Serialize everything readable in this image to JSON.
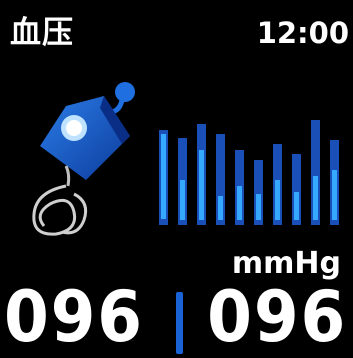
{
  "header": {
    "title": "血压",
    "time": "12:00"
  },
  "icons": {
    "cuff": "blood-pressure-cuff-icon",
    "chart": "pressure-bars-icon"
  },
  "reading": {
    "unit": "mmHg",
    "systolic": "096",
    "diastolic": "096"
  },
  "colors": {
    "background": "#000000",
    "text": "#ffffff",
    "accent_blue": "#1a63d6",
    "bright_blue": "#35a8ff"
  }
}
